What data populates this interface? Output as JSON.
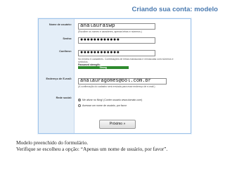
{
  "slide": {
    "title": "Criando sua conta: modelo"
  },
  "form": {
    "username": {
      "label": "Nome de usuário:",
      "value": "analauraswp",
      "hint": "(Escolher os nomes e caracteres, apenas letras e números.)"
    },
    "password": {
      "label": "Senha:",
      "value": "●●●●●●●●●●●●"
    },
    "confirm": {
      "label": "Confirme:",
      "value": "●●●●●●●●●●●●",
      "hint": "No mínimo 6 caracteres. Combinações de letras maiúsculas e minúsculas com números e símbolos.",
      "strength_label": "Password strength:",
      "strength_value": "Strong",
      "strength_fraction": 0.65,
      "strength_color": "#2e8b2e"
    },
    "email": {
      "label": "Endereço de E-mail:",
      "value": "analauragomes@bol.com.br",
      "hint": "(A confirmação do cadastro será enviada para esse endereço de e-mail.)"
    },
    "network": {
      "label": "Rede social:",
      "options": [
        {
          "text": "Me ativar no Ning! (Conter usuario www.domain.com)",
          "selected": true
        },
        {
          "text": "Acessar um nome de usuário, por favor",
          "selected": false
        }
      ]
    },
    "next_label": "Próximo »"
  },
  "caption": {
    "line1": "Modelo preenchido do formulário.",
    "line2": "Verifique se escolheu a opção: “Apenas um nome de usuário, por favor”."
  }
}
